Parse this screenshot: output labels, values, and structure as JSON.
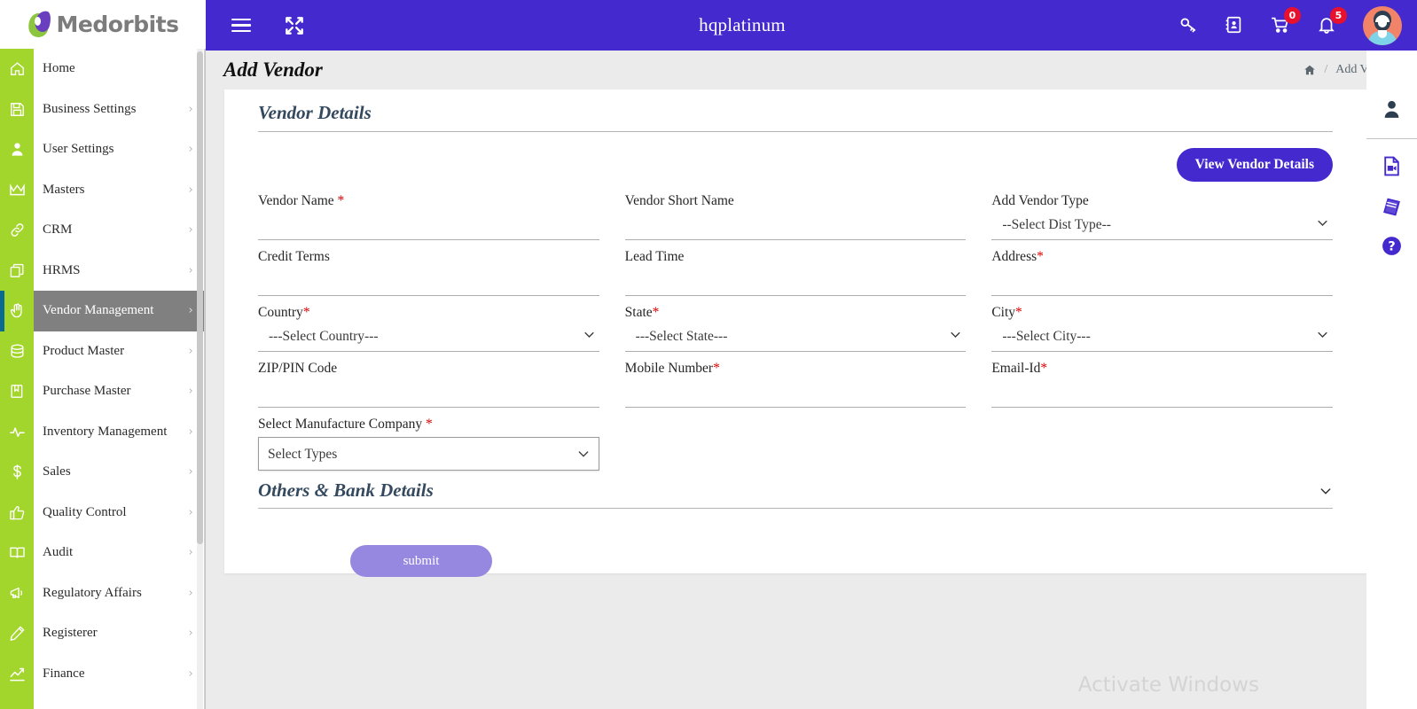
{
  "brand": {
    "name": "Medorbits"
  },
  "topbar": {
    "title": "hqplatinum",
    "menu_icon": "hamburger-icon",
    "expand_icon": "expand-arrows-icon",
    "key_icon": "key-icon",
    "book_icon": "address-book-icon",
    "cart_icon": "cart-icon",
    "cart_badge": "0",
    "bell_icon": "bell-icon",
    "bell_badge": "5",
    "avatar_alt": "user-avatar"
  },
  "page": {
    "title": "Add Vendor",
    "breadcrumb_home_icon": "home-icon",
    "breadcrumb_separator": "/",
    "breadcrumb_current": "Add Vendor"
  },
  "card": {
    "section_title": "Vendor Details",
    "view_button": "View Vendor Details",
    "collapse_title": "Others & Bank Details",
    "submit_button": "submit"
  },
  "fields": {
    "vendor_name": {
      "label": "Vendor Name",
      "required": true,
      "value": "",
      "placeholder": ""
    },
    "vendor_short": {
      "label": "Vendor Short Name",
      "required": false,
      "value": "",
      "placeholder": ""
    },
    "vendor_type": {
      "label": "Add Vendor Type",
      "required": false,
      "selected": "--Select Dist Type--",
      "options": [
        "--Select Dist Type--"
      ]
    },
    "credit_terms": {
      "label": "Credit Terms",
      "required": false,
      "value": "",
      "placeholder": ""
    },
    "lead_time": {
      "label": "Lead Time",
      "required": false,
      "value": "",
      "placeholder": ""
    },
    "address": {
      "label": "Address",
      "required": true,
      "value": "",
      "placeholder": ""
    },
    "country": {
      "label": "Country",
      "required": true,
      "selected": "---Select Country---",
      "options": [
        "---Select Country---"
      ]
    },
    "state": {
      "label": "State",
      "required": true,
      "selected": "---Select State---",
      "options": [
        "---Select State---"
      ]
    },
    "city": {
      "label": "City",
      "required": true,
      "selected": "---Select City---",
      "options": [
        "---Select City---"
      ]
    },
    "zip": {
      "label": "ZIP/PIN Code",
      "required": false,
      "value": "",
      "placeholder": ""
    },
    "mobile": {
      "label": "Mobile Number",
      "required": true,
      "value": "",
      "placeholder": ""
    },
    "email": {
      "label": "Email-Id",
      "required": true,
      "value": "",
      "placeholder": ""
    },
    "manufacture": {
      "label": "Select Manufacture Company",
      "required": true,
      "selected": "Select Types",
      "options": [
        "Select Types"
      ]
    }
  },
  "sidebar": {
    "items": [
      {
        "label": "Home",
        "icon": "home-icon",
        "chevron": false,
        "active": false
      },
      {
        "label": "Business Settings",
        "icon": "save-icon",
        "chevron": true,
        "active": false
      },
      {
        "label": "User Settings",
        "icon": "user-icon",
        "chevron": true,
        "active": false
      },
      {
        "label": "Masters",
        "icon": "crown-icon",
        "chevron": true,
        "active": false
      },
      {
        "label": "CRM",
        "icon": "link-icon",
        "chevron": true,
        "active": false
      },
      {
        "label": "HRMS",
        "icon": "copy-icon",
        "chevron": true,
        "active": false
      },
      {
        "label": "Vendor Management",
        "icon": "hand-icon",
        "chevron": true,
        "active": true
      },
      {
        "label": "Product Master",
        "icon": "database-icon",
        "chevron": true,
        "active": false
      },
      {
        "label": "Purchase Master",
        "icon": "book-open-icon",
        "chevron": true,
        "active": false
      },
      {
        "label": "Inventory Management",
        "icon": "pulse-icon",
        "chevron": true,
        "active": false
      },
      {
        "label": "Sales",
        "icon": "dollar-icon",
        "chevron": true,
        "active": false
      },
      {
        "label": "Quality Control",
        "icon": "thumbs-up-icon",
        "chevron": true,
        "active": false
      },
      {
        "label": "Audit",
        "icon": "book-icon",
        "chevron": true,
        "active": false
      },
      {
        "label": "Regulatory Affairs",
        "icon": "megaphone-icon",
        "chevron": true,
        "active": false
      },
      {
        "label": "Registerer",
        "icon": "pencil-icon",
        "chevron": true,
        "active": false
      },
      {
        "label": "Finance",
        "icon": "chart-line-icon",
        "chevron": true,
        "active": false
      }
    ],
    "chevron_glyph": "›"
  },
  "right_rail": {
    "items": [
      {
        "icon": "profile-icon"
      },
      {
        "icon": "video-file-icon"
      },
      {
        "icon": "books-icon"
      },
      {
        "icon": "help-circle-icon"
      }
    ]
  },
  "watermark": "Activate Windows",
  "colors": {
    "primary": "#4429ce",
    "sidebar_rail": "#a3d62c",
    "active_nav": "#808080",
    "badge": "#e8112d",
    "submit": "#9688e0",
    "required": "#e00000"
  }
}
